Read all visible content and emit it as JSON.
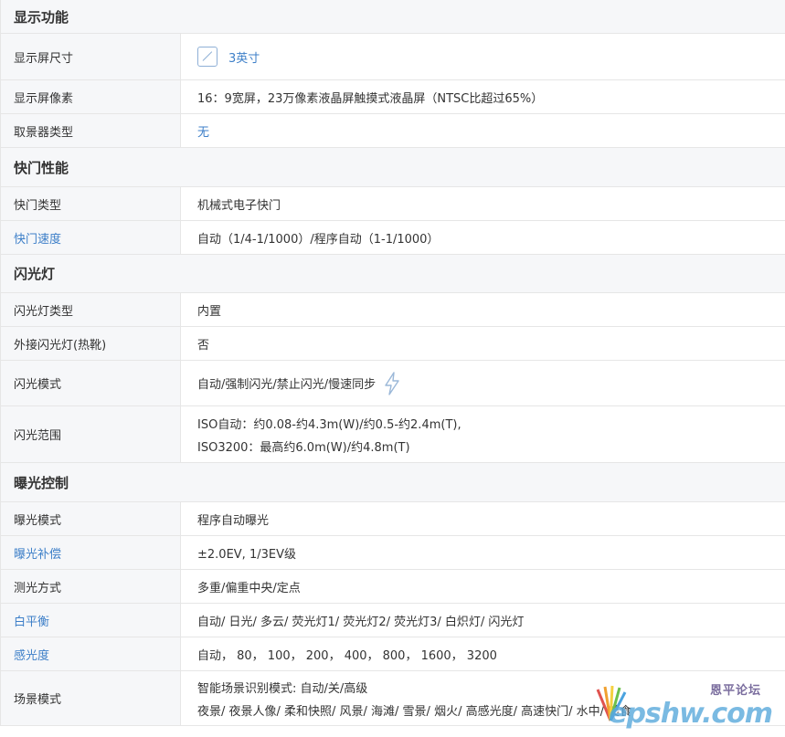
{
  "sections": [
    {
      "title": "显示功能",
      "rows": [
        {
          "label": "显示屏尺寸",
          "value": "3英寸",
          "label_link": false,
          "value_link": true,
          "icon": "screen-size-icon"
        },
        {
          "label": "显示屏像素",
          "value": "16：9宽屏，23万像素液晶屏触摸式液晶屏（NTSC比超过65%）"
        },
        {
          "label": "取景器类型",
          "value": "无",
          "value_link": true
        }
      ]
    },
    {
      "title": "快门性能",
      "rows": [
        {
          "label": "快门类型",
          "value": "机械式电子快门"
        },
        {
          "label": "快门速度",
          "value": "自动（1/4-1/1000）/程序自动（1-1/1000）",
          "label_link": true
        }
      ]
    },
    {
      "title": "闪光灯",
      "rows": [
        {
          "label": "闪光灯类型",
          "value": "内置"
        },
        {
          "label": "外接闪光灯(热靴)",
          "value": "否"
        },
        {
          "label": "闪光模式",
          "value": "自动/强制闪光/禁止闪光/慢速同步",
          "icon": "flash-icon"
        },
        {
          "label": "闪光范围",
          "lines": [
            "ISO自动：约0.08-约4.3m(W)/约0.5-约2.4m(T),",
            "ISO3200：最高约6.0m(W)/约4.8m(T)"
          ]
        }
      ]
    },
    {
      "title": "曝光控制",
      "rows": [
        {
          "label": "曝光模式",
          "value": "程序自动曝光"
        },
        {
          "label": "曝光补偿",
          "value": "±2.0EV, 1/3EV级",
          "label_link": true
        },
        {
          "label": "测光方式",
          "value": "多重/偏重中央/定点"
        },
        {
          "label": "白平衡",
          "value": "自动/ 日光/ 多云/ 荧光灯1/ 荧光灯2/ 荧光灯3/ 白炽灯/ 闪光灯",
          "label_link": true
        },
        {
          "label": "感光度",
          "value": "自动， 80， 100， 200， 400， 800， 1600， 3200",
          "label_link": true
        },
        {
          "label": "场景模式",
          "lines": [
            "智能场景识别模式: 自动/关/高级",
            "夜景/ 夜景人像/ 柔和快照/ 风景/ 海滩/ 雪景/ 烟火/ 高感光度/ 高速快门/ 水中/ 美食"
          ]
        }
      ]
    }
  ],
  "watermark": {
    "cn": "恩平论坛",
    "en": "epshw.com"
  },
  "colors": {
    "link": "#3d7fc8",
    "label_bg": "#f6f7f9",
    "border": "#e6e6e6"
  }
}
